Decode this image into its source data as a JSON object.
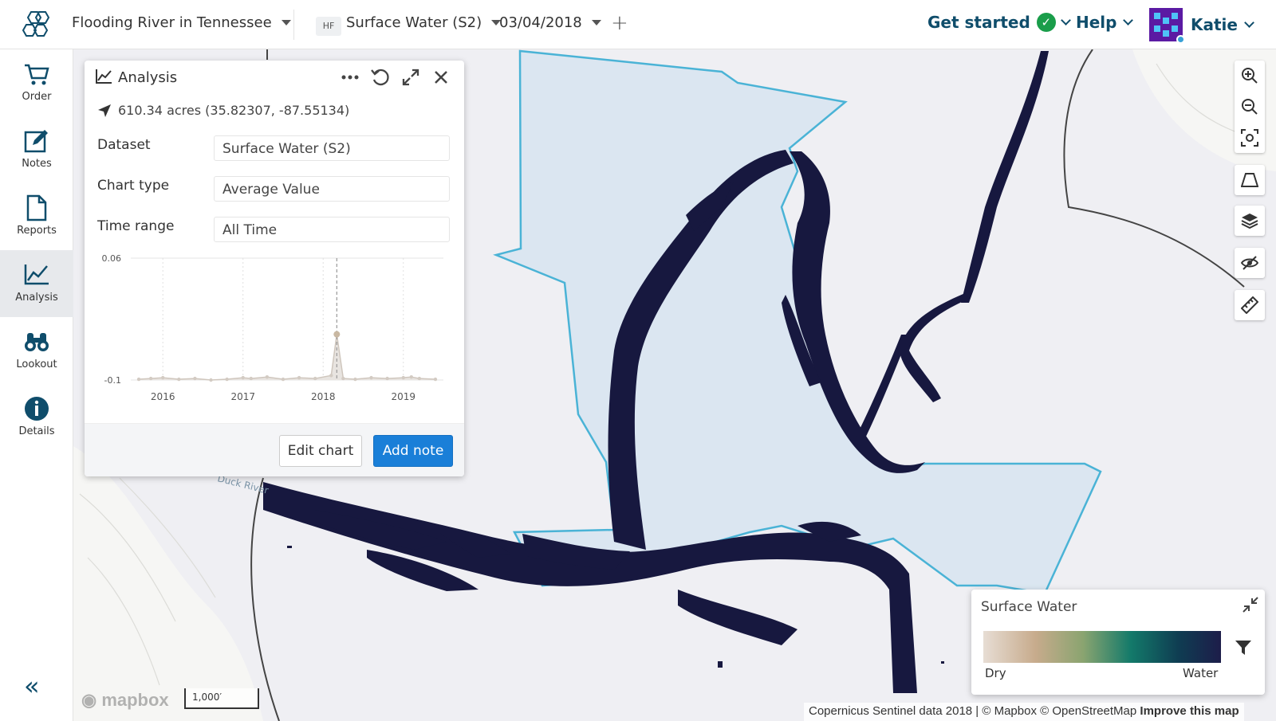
{
  "header": {
    "project_title": "Flooding River in Tennessee",
    "dataset_tag": "HF",
    "dataset_name": "Surface Water (S2)",
    "date": "03/04/2018",
    "add_symbol": "+",
    "get_started": "Get started",
    "help": "Help",
    "user_name": "Katie"
  },
  "sidebar": {
    "items": [
      {
        "label": "Order",
        "icon": "cart-icon"
      },
      {
        "label": "Notes",
        "icon": "notes-icon"
      },
      {
        "label": "Reports",
        "icon": "report-icon"
      },
      {
        "label": "Analysis",
        "icon": "analysis-icon"
      },
      {
        "label": "Lookout",
        "icon": "binoculars-icon"
      },
      {
        "label": "Details",
        "icon": "info-icon"
      }
    ],
    "active": "Analysis",
    "collapse_symbol": "«"
  },
  "analysis_panel": {
    "title": "Analysis",
    "coords": "610.34 acres (35.82307, -87.55134)",
    "fields": [
      {
        "label": "Dataset",
        "value": "Surface Water (S2)"
      },
      {
        "label": "Chart type",
        "value": "Average Value"
      },
      {
        "label": "Time range",
        "value": "All Time"
      }
    ],
    "edit_button": "Edit chart",
    "add_button": "Add note"
  },
  "chart_data": {
    "type": "line",
    "title": "",
    "xlabel": "",
    "ylabel": "",
    "y_ticks": [
      "0.06",
      "-0.1"
    ],
    "ylim": [
      -0.1,
      0.06
    ],
    "x_ticks": [
      "2016",
      "2017",
      "2018",
      "2019"
    ],
    "xlim": [
      2015.6,
      2019.5
    ],
    "marker": {
      "x": 2018.17,
      "y": -0.04
    },
    "series": [
      {
        "x": [
          2015.7,
          2015.85,
          2016.0,
          2016.2,
          2016.4,
          2016.6,
          2016.8,
          2017.0,
          2017.1,
          2017.3,
          2017.5,
          2017.7,
          2017.9,
          2018.1,
          2018.17,
          2018.25,
          2018.4,
          2018.6,
          2018.8,
          2019.0,
          2019.1,
          2019.2,
          2019.4
        ],
        "values": [
          -0.099,
          -0.098,
          -0.097,
          -0.099,
          -0.098,
          -0.1,
          -0.099,
          -0.097,
          -0.098,
          -0.096,
          -0.099,
          -0.097,
          -0.098,
          -0.094,
          -0.04,
          -0.098,
          -0.099,
          -0.097,
          -0.098,
          -0.097,
          -0.096,
          -0.098,
          -0.099
        ]
      }
    ]
  },
  "tools": [
    {
      "name": "zoom-in-icon"
    },
    {
      "name": "zoom-out-icon"
    },
    {
      "name": "fit-bounds-icon"
    },
    {
      "name": "perspective-icon"
    },
    {
      "name": "layers-icon"
    },
    {
      "name": "hide-icon"
    },
    {
      "name": "ruler-icon"
    }
  ],
  "legend": {
    "title": "Surface Water",
    "low_label": "Dry",
    "high_label": "Water"
  },
  "map": {
    "mapbox_logo": "mapbox",
    "scale_label": "1,000′",
    "attribution": "Copernicus Sentinel data 2018 | © Mapbox © OpenStreetMap",
    "improve_link": "Improve this map",
    "river_label": "Duck River"
  },
  "colors": {
    "accent": "#1a7fd8",
    "brand": "#0f4d6b",
    "water": "#17183f",
    "aoi_fill": "#dbe6f1",
    "aoi_stroke": "#4ab3d6"
  }
}
